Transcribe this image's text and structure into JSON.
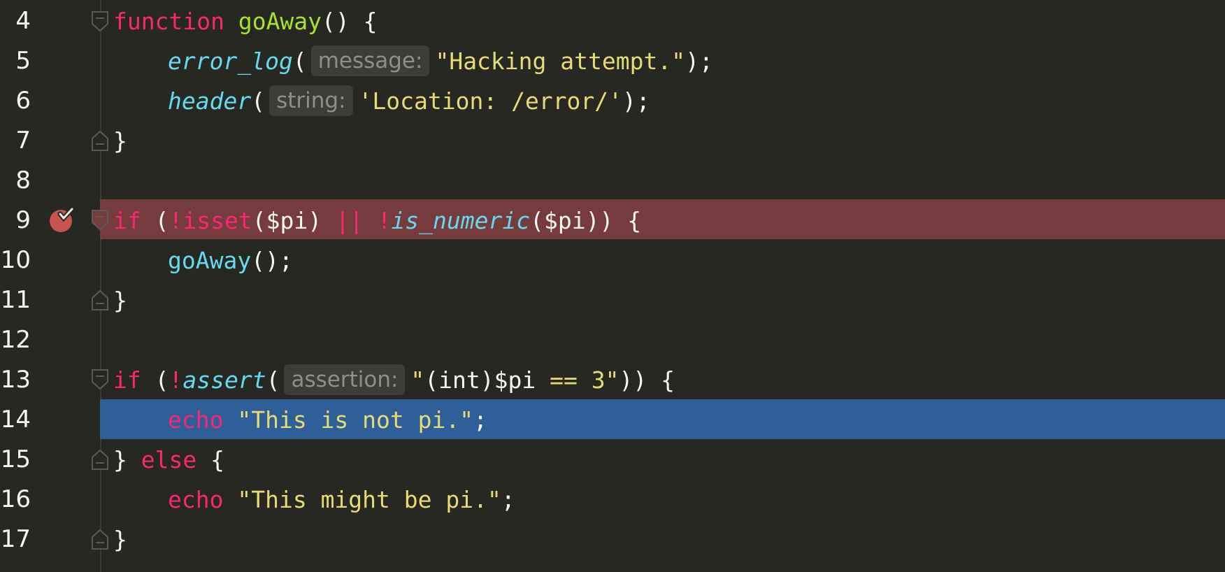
{
  "editor": {
    "lines": [
      {
        "num": "4"
      },
      {
        "num": "5"
      },
      {
        "num": "6"
      },
      {
        "num": "7"
      },
      {
        "num": "8"
      },
      {
        "num": "9"
      },
      {
        "num": "10"
      },
      {
        "num": "11"
      },
      {
        "num": "12"
      },
      {
        "num": "13"
      },
      {
        "num": "14"
      },
      {
        "num": "15"
      },
      {
        "num": "16"
      },
      {
        "num": "17"
      }
    ],
    "code": {
      "l4": {
        "kw_function": "function",
        "name": "goAway",
        "rest": "() {"
      },
      "l5": {
        "fn": "error_log",
        "open": "(",
        "hint": "message:",
        "str": "\"Hacking attempt.\"",
        "close": ");"
      },
      "l6": {
        "fn": "header",
        "open": "(",
        "hint": "string:",
        "str": "'Location: /error/'",
        "close": ");"
      },
      "l7": {
        "text": "}"
      },
      "l9": {
        "kw_if": "if",
        "p1": " (",
        "not1": "!",
        "isset": "isset",
        "p2": "($pi) ",
        "or": "||",
        "sp": " ",
        "not2": "!",
        "fn": "is_numeric",
        "p3": "($pi)) {"
      },
      "l10": {
        "fn": "goAway",
        "rest": "();"
      },
      "l11": {
        "text": "}"
      },
      "l13": {
        "kw_if": "if",
        "p1": " (",
        "not": "!",
        "fn": "assert",
        "open": "(",
        "hint": "assertion:",
        "q1": "\"",
        "p_int": "(int)",
        "var": "$pi",
        "op": " == ",
        "num": "3",
        "q2": "\"",
        "close": ")) {"
      },
      "l14": {
        "kw_echo": "echo",
        "str": "\"This is not pi.\"",
        "semi": ";"
      },
      "l15": {
        "b": "} ",
        "kw_else": "else",
        "rest": " {"
      },
      "l16": {
        "kw_echo": "echo",
        "str": "\"This might be pi.\"",
        "semi": ";"
      },
      "l17": {
        "text": "}"
      }
    },
    "breakpoint_line": "9",
    "current_line": "14"
  }
}
